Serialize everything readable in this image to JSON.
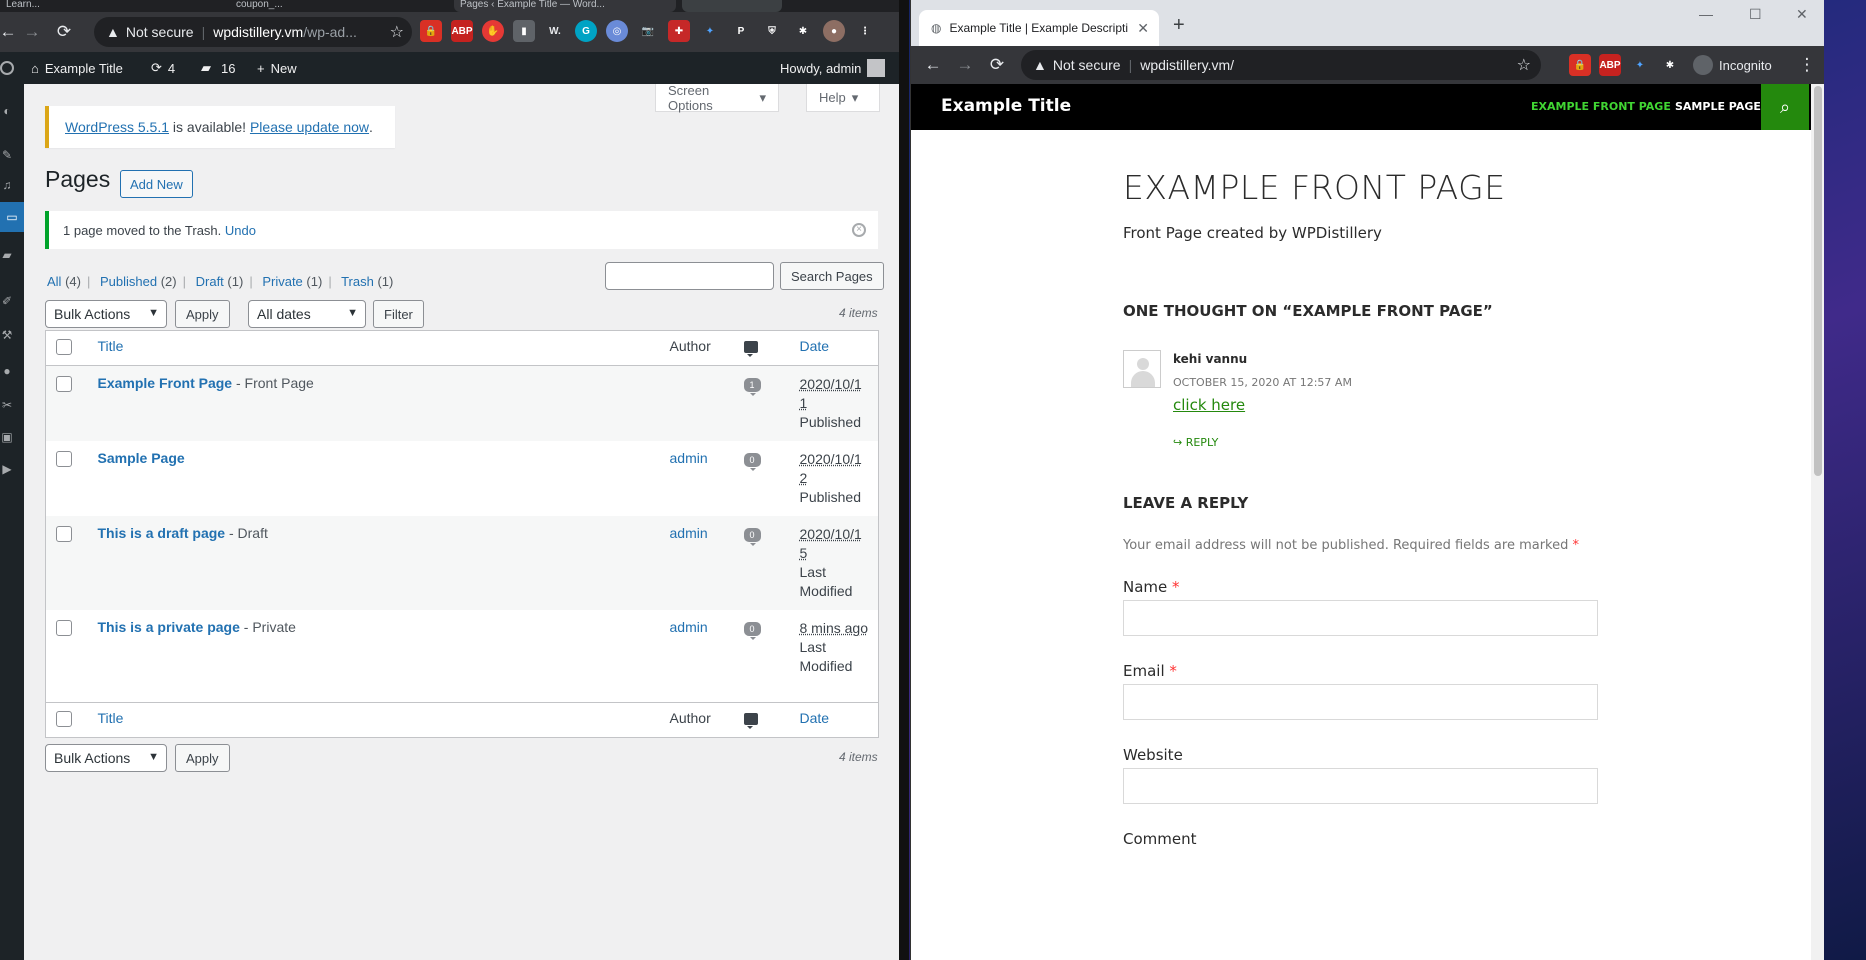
{
  "left_browser": {
    "tabs": [
      "Learn...",
      "coupon_...",
      "Pages ‹ Example Title — Word...",
      ""
    ],
    "url": {
      "security": "Not secure",
      "host": "wpdistillery.vm",
      "path": "/wp-ad..."
    },
    "extensions": [
      "ABP",
      "W.",
      "G",
      "P"
    ]
  },
  "wp_admin_bar": {
    "site_name": "Example Title",
    "updates": "4",
    "comments": "16",
    "new_label": "New",
    "howdy": "Howdy, admin"
  },
  "wp_admin": {
    "screen_options": "Screen Options",
    "help": "Help",
    "update_notice": {
      "link1": "WordPress 5.5.1",
      "text": " is available! ",
      "link2": "Please update now",
      "end": "."
    },
    "page_title": "Pages",
    "add_new": "Add New",
    "trash_notice": {
      "text": "1 page moved to the Trash. ",
      "undo": "Undo"
    },
    "filters": [
      {
        "label": "All",
        "count": "(4)"
      },
      {
        "label": "Published",
        "count": "(2)"
      },
      {
        "label": "Draft",
        "count": "(1)"
      },
      {
        "label": "Private",
        "count": "(1)"
      },
      {
        "label": "Trash",
        "count": "(1)"
      }
    ],
    "search_button": "Search Pages",
    "bulk_actions": "Bulk Actions",
    "apply": "Apply",
    "all_dates": "All dates",
    "filter": "Filter",
    "items_count": "4 items",
    "columns": {
      "title": "Title",
      "author": "Author",
      "date": "Date"
    },
    "rows": [
      {
        "title": "Example Front Page",
        "state": " - Front Page",
        "author": "",
        "comments": "1",
        "date": "2020/10/11",
        "status": "Published"
      },
      {
        "title": "Sample Page",
        "state": "",
        "author": "admin",
        "comments": "0",
        "date": "2020/10/12",
        "status": "Published"
      },
      {
        "title": "This is a draft page",
        "state": " - Draft",
        "author": "admin",
        "comments": "0",
        "date": "2020/10/15",
        "status": "Last Modified"
      },
      {
        "title": "This is a private page",
        "state": " - Private",
        "author": "admin",
        "comments": "0",
        "date": "8 mins ago",
        "status": "Last Modified"
      }
    ]
  },
  "right_browser": {
    "tab_title": "Example Title | Example Descripti",
    "url": {
      "security": "Not secure",
      "host": "wpdistillery.vm/"
    },
    "incognito": "Incognito",
    "extensions": [
      "ABP"
    ]
  },
  "site": {
    "title": "Example Title",
    "nav": [
      "EXAMPLE FRONT PAGE",
      "SAMPLE PAGE"
    ],
    "entry_title": "EXAMPLE FRONT PAGE",
    "entry_content": "Front Page created by WPDistillery",
    "comments_title": "ONE THOUGHT ON “EXAMPLE FRONT PAGE”",
    "comment": {
      "author": "kehi vannu",
      "date": "OCTOBER 15, 2020 AT 12:57 AM",
      "link": "click here",
      "reply": "REPLY"
    },
    "reply_title": "LEAVE A REPLY",
    "notes": "Your email address will not be published. Required fields are marked ",
    "fields": {
      "name": "Name",
      "email": "Email",
      "website": "Website",
      "comment": "Comment"
    },
    "accent": "#24890d"
  }
}
